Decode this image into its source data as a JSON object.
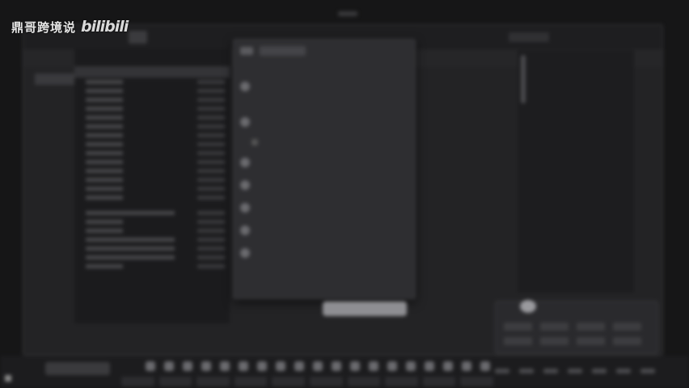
{
  "watermark": {
    "text": "鼎哥跨境说",
    "logo": "bilibili"
  },
  "colors": {
    "background": "#161617",
    "window": "#232325",
    "menu": "#2e2e31",
    "button": "#8e8e92"
  },
  "icons": [
    "start-icon",
    "avatar-icon",
    "menu-item-icon"
  ]
}
